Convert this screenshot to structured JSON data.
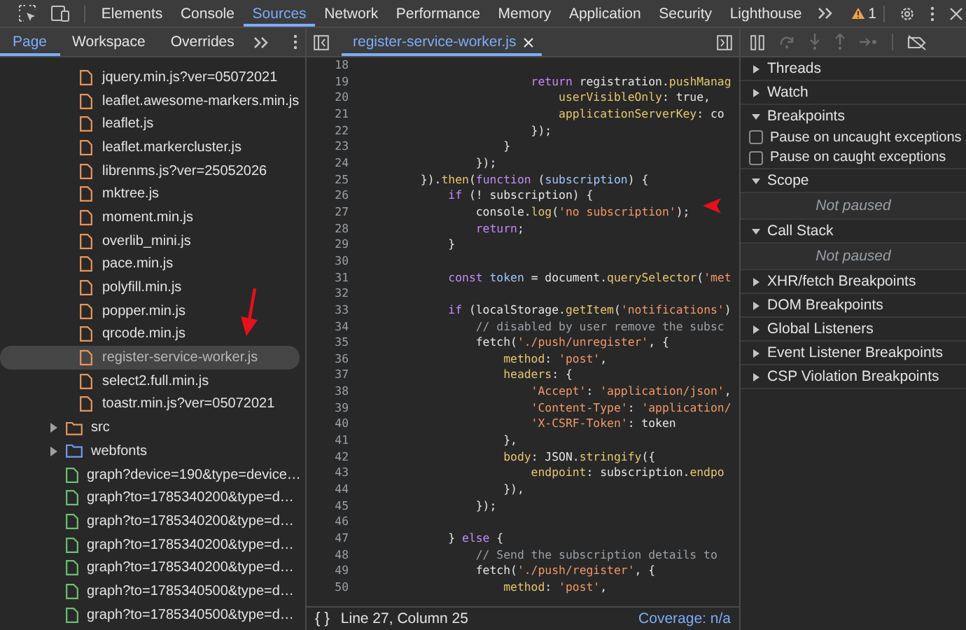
{
  "main_tabs": [
    {
      "label": "Elements",
      "selected": false
    },
    {
      "label": "Console",
      "selected": false
    },
    {
      "label": "Sources",
      "selected": true
    },
    {
      "label": "Network",
      "selected": false
    },
    {
      "label": "Performance",
      "selected": false
    },
    {
      "label": "Memory",
      "selected": false
    },
    {
      "label": "Application",
      "selected": false
    },
    {
      "label": "Security",
      "selected": false
    },
    {
      "label": "Lighthouse",
      "selected": false
    }
  ],
  "warning_count": "1",
  "navigator": {
    "tabs": [
      {
        "label": "Page",
        "selected": true
      },
      {
        "label": "Workspace",
        "selected": false
      },
      {
        "label": "Overrides",
        "selected": false
      }
    ],
    "open_folder_files": [
      {
        "name": "jquery.min.js?ver=05072021",
        "kind": "script",
        "selected": false
      },
      {
        "name": "leaflet.awesome-markers.min.js",
        "kind": "script",
        "selected": false
      },
      {
        "name": "leaflet.js",
        "kind": "script",
        "selected": false
      },
      {
        "name": "leaflet.markercluster.js",
        "kind": "script",
        "selected": false
      },
      {
        "name": "librenms.js?ver=25052026",
        "kind": "script",
        "selected": false
      },
      {
        "name": "mktree.js",
        "kind": "script",
        "selected": false
      },
      {
        "name": "moment.min.js",
        "kind": "script",
        "selected": false
      },
      {
        "name": "overlib_mini.js",
        "kind": "script",
        "selected": false
      },
      {
        "name": "pace.min.js",
        "kind": "script",
        "selected": false
      },
      {
        "name": "polyfill.min.js",
        "kind": "script",
        "selected": false
      },
      {
        "name": "popper.min.js",
        "kind": "script",
        "selected": false
      },
      {
        "name": "qrcode.min.js",
        "kind": "script",
        "selected": false
      },
      {
        "name": "register-service-worker.js",
        "kind": "script",
        "selected": true
      },
      {
        "name": "select2.full.min.js",
        "kind": "script",
        "selected": false
      },
      {
        "name": "toastr.min.js?ver=05072021",
        "kind": "script",
        "selected": false
      }
    ],
    "items": [
      {
        "name": "src",
        "kind": "folder",
        "color": "#e8955b",
        "expanded": false,
        "selected": false
      },
      {
        "name": "webfonts",
        "kind": "folder",
        "color": "#6f9bf0",
        "expanded": false,
        "selected": false
      },
      {
        "name": "graph?device=190&type=device…",
        "kind": "document",
        "selected": false
      },
      {
        "name": "graph?to=1785340200&type=d…",
        "kind": "document",
        "selected": false
      },
      {
        "name": "graph?to=1785340200&type=d…",
        "kind": "document",
        "selected": false
      },
      {
        "name": "graph?to=1785340200&type=d…",
        "kind": "document",
        "selected": false
      },
      {
        "name": "graph?to=1785340200&type=d…",
        "kind": "document",
        "selected": false
      },
      {
        "name": "graph?to=1785340500&type=d…",
        "kind": "document",
        "selected": false
      },
      {
        "name": "graph?to=1785340500&type=d…",
        "kind": "document",
        "selected": false
      }
    ]
  },
  "editor": {
    "tabs": [
      {
        "label": "register-service-worker.js",
        "selected": true
      }
    ],
    "lines": [
      {
        "num": "18"
      },
      {
        "num": "19",
        "code": [
          {
            "t": "                        return",
            "kind": "keyword"
          },
          {
            "t": " registration."
          },
          {
            "t": "pushManag",
            "kind": "function"
          }
        ]
      },
      {
        "num": "20",
        "code": [
          {
            "t": "                            userVisibleOnly",
            "kind": "property"
          },
          {
            "t": ": true,"
          }
        ]
      },
      {
        "num": "21",
        "code": [
          {
            "t": "                            applicationServerKey",
            "kind": "property"
          },
          {
            "t": ": co"
          }
        ]
      },
      {
        "num": "22",
        "code": [
          {
            "t": "                        });"
          }
        ]
      },
      {
        "num": "23",
        "code": [
          {
            "t": "                    }"
          }
        ]
      },
      {
        "num": "24",
        "code": [
          {
            "t": "                });"
          }
        ]
      },
      {
        "num": "25",
        "code": [
          {
            "t": "        })."
          },
          {
            "t": "then",
            "kind": "function"
          },
          {
            "t": "("
          },
          {
            "t": "function",
            "kind": "keyword"
          },
          {
            "t": " ("
          },
          {
            "t": "subscription",
            "kind": "definition"
          },
          {
            "t": ") {"
          }
        ]
      },
      {
        "num": "26",
        "code": [
          {
            "t": "            if",
            "kind": "keyword"
          },
          {
            "t": " (! subscription) {"
          }
        ]
      },
      {
        "num": "27",
        "code": [
          {
            "t": "                console."
          },
          {
            "t": "log",
            "kind": "function"
          },
          {
            "t": "("
          },
          {
            "t": "'no subscription'",
            "kind": "string"
          },
          {
            "t": ");"
          }
        ]
      },
      {
        "num": "28",
        "code": [
          {
            "t": "                return",
            "kind": "keyword"
          },
          {
            "t": ";"
          }
        ]
      },
      {
        "num": "29",
        "code": [
          {
            "t": "            }"
          }
        ]
      },
      {
        "num": "30"
      },
      {
        "num": "31",
        "code": [
          {
            "t": "            const",
            "kind": "keyword"
          },
          {
            "t": " token",
            "kind": "definition"
          },
          {
            "t": " = document."
          },
          {
            "t": "querySelector",
            "kind": "function"
          },
          {
            "t": "("
          },
          {
            "t": "'met",
            "kind": "string"
          }
        ]
      },
      {
        "num": "32"
      },
      {
        "num": "33",
        "code": [
          {
            "t": "            if",
            "kind": "keyword"
          },
          {
            "t": " (localStorage."
          },
          {
            "t": "getItem",
            "kind": "function"
          },
          {
            "t": "("
          },
          {
            "t": "'notifications'",
            "kind": "string"
          },
          {
            "t": ")"
          }
        ]
      },
      {
        "num": "34",
        "code": [
          {
            "t": "                // disabled by user remove the subsc",
            "kind": "comment"
          }
        ]
      },
      {
        "num": "35",
        "code": [
          {
            "t": "                fetch("
          },
          {
            "t": "'./push/unregister'",
            "kind": "string"
          },
          {
            "t": ", {"
          }
        ]
      },
      {
        "num": "36",
        "code": [
          {
            "t": "                    method",
            "kind": "property"
          },
          {
            "t": ": "
          },
          {
            "t": "'post'",
            "kind": "string"
          },
          {
            "t": ","
          }
        ]
      },
      {
        "num": "37",
        "code": [
          {
            "t": "                    headers",
            "kind": "property"
          },
          {
            "t": ": {"
          }
        ]
      },
      {
        "num": "38",
        "code": [
          {
            "t": "                        'Accept'",
            "kind": "string"
          },
          {
            "t": ": "
          },
          {
            "t": "'application/json'",
            "kind": "string"
          },
          {
            "t": ","
          }
        ]
      },
      {
        "num": "39",
        "code": [
          {
            "t": "                        'Content-Type'",
            "kind": "string"
          },
          {
            "t": ": "
          },
          {
            "t": "'application/",
            "kind": "string"
          }
        ]
      },
      {
        "num": "40",
        "code": [
          {
            "t": "                        'X-CSRF-Token'",
            "kind": "string"
          },
          {
            "t": ": token"
          }
        ]
      },
      {
        "num": "41",
        "code": [
          {
            "t": "                    },"
          }
        ]
      },
      {
        "num": "42",
        "code": [
          {
            "t": "                    body",
            "kind": "property"
          },
          {
            "t": ": JSON."
          },
          {
            "t": "stringify",
            "kind": "function"
          },
          {
            "t": "({"
          }
        ]
      },
      {
        "num": "43",
        "code": [
          {
            "t": "                        endpoint",
            "kind": "property"
          },
          {
            "t": ": subscription."
          },
          {
            "t": "endpo",
            "kind": "property"
          }
        ]
      },
      {
        "num": "44",
        "code": [
          {
            "t": "                    }),"
          }
        ]
      },
      {
        "num": "45",
        "code": [
          {
            "t": "                });"
          }
        ]
      },
      {
        "num": "46"
      },
      {
        "num": "47",
        "code": [
          {
            "t": "            } "
          },
          {
            "t": "else",
            "kind": "keyword"
          },
          {
            "t": " {"
          }
        ]
      },
      {
        "num": "48",
        "code": [
          {
            "t": "                // Send the subscription details to",
            "kind": "comment"
          }
        ]
      },
      {
        "num": "49",
        "code": [
          {
            "t": "                fetch("
          },
          {
            "t": "'./push/register'",
            "kind": "string"
          },
          {
            "t": ", {"
          }
        ]
      },
      {
        "num": "50",
        "code": [
          {
            "t": "                    method",
            "kind": "property"
          },
          {
            "t": ": "
          },
          {
            "t": "'post'",
            "kind": "string"
          },
          {
            "t": ","
          }
        ]
      }
    ],
    "status": {
      "format": "{ }",
      "position": "Line 27, Column 25",
      "coverage": "Coverage: n/a"
    }
  },
  "debugger": {
    "sections": [
      {
        "title": "Threads",
        "expanded": false
      },
      {
        "title": "Watch",
        "expanded": false
      },
      {
        "title": "Breakpoints",
        "expanded": true,
        "options": [
          {
            "label": "Pause on uncaught exceptions",
            "checked": false
          },
          {
            "label": "Pause on caught exceptions",
            "checked": false
          }
        ]
      },
      {
        "title": "Scope",
        "expanded": true,
        "message": "Not paused"
      },
      {
        "title": "Call Stack",
        "expanded": true,
        "message": "Not paused"
      },
      {
        "title": "XHR/fetch Breakpoints",
        "expanded": false
      },
      {
        "title": "DOM Breakpoints",
        "expanded": false
      },
      {
        "title": "Global Listeners",
        "expanded": false
      },
      {
        "title": "Event Listener Breakpoints",
        "expanded": false
      },
      {
        "title": "CSP Violation Breakpoints",
        "expanded": false
      }
    ]
  }
}
